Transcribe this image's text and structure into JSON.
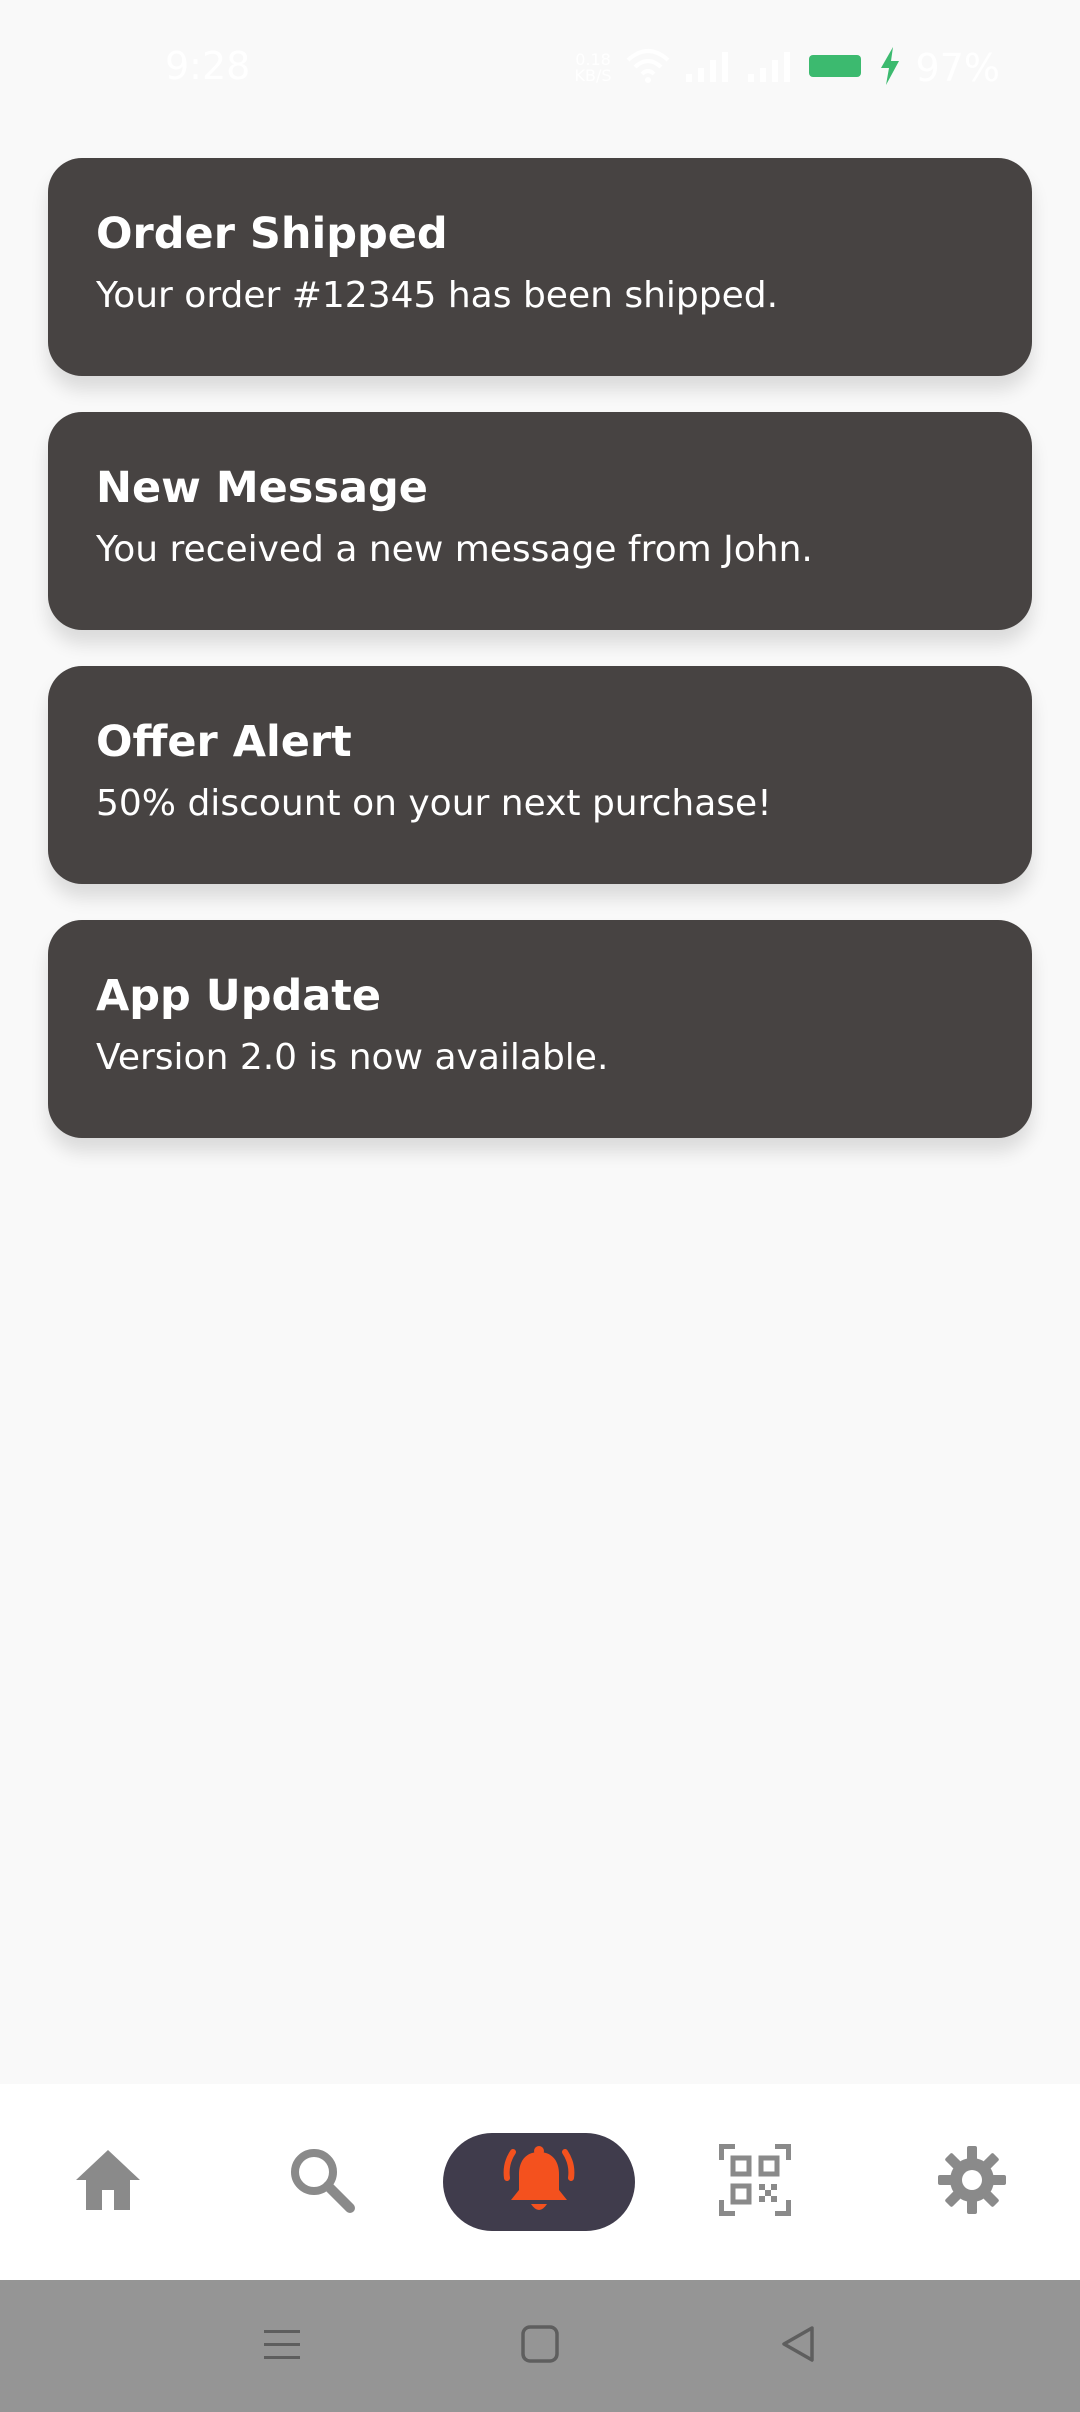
{
  "status_bar": {
    "time": "9:28",
    "net_speed_value": "0.18",
    "net_speed_unit": "KB/S",
    "battery_percent": "97%",
    "battery_color": "#3cba6f"
  },
  "notifications": [
    {
      "title": "Order Shipped",
      "message": "Your order #12345 has been shipped."
    },
    {
      "title": "New Message",
      "message": "You received a new message from John."
    },
    {
      "title": "Offer Alert",
      "message": "50% discount on your next purchase!"
    },
    {
      "title": "App Update",
      "message": "Version 2.0 is now available."
    }
  ],
  "bottom_nav": {
    "items": [
      {
        "icon": "home-icon",
        "selected": false
      },
      {
        "icon": "search-icon",
        "selected": false
      },
      {
        "icon": "bell-ringing-icon",
        "selected": true
      },
      {
        "icon": "qr-code-scan-icon",
        "selected": false
      },
      {
        "icon": "gear-icon",
        "selected": false
      }
    ],
    "active_icon_color": "#f4511e",
    "inactive_icon_color": "#8a8a8a",
    "active_pill_color": "#403c4c"
  },
  "system_nav": {
    "buttons": [
      "menu-icon",
      "home-square-icon",
      "back-triangle-icon"
    ]
  },
  "colors": {
    "background": "#f9f9f9",
    "card_background": "#474342",
    "card_text": "#ffffff",
    "system_nav_background": "#959595"
  }
}
